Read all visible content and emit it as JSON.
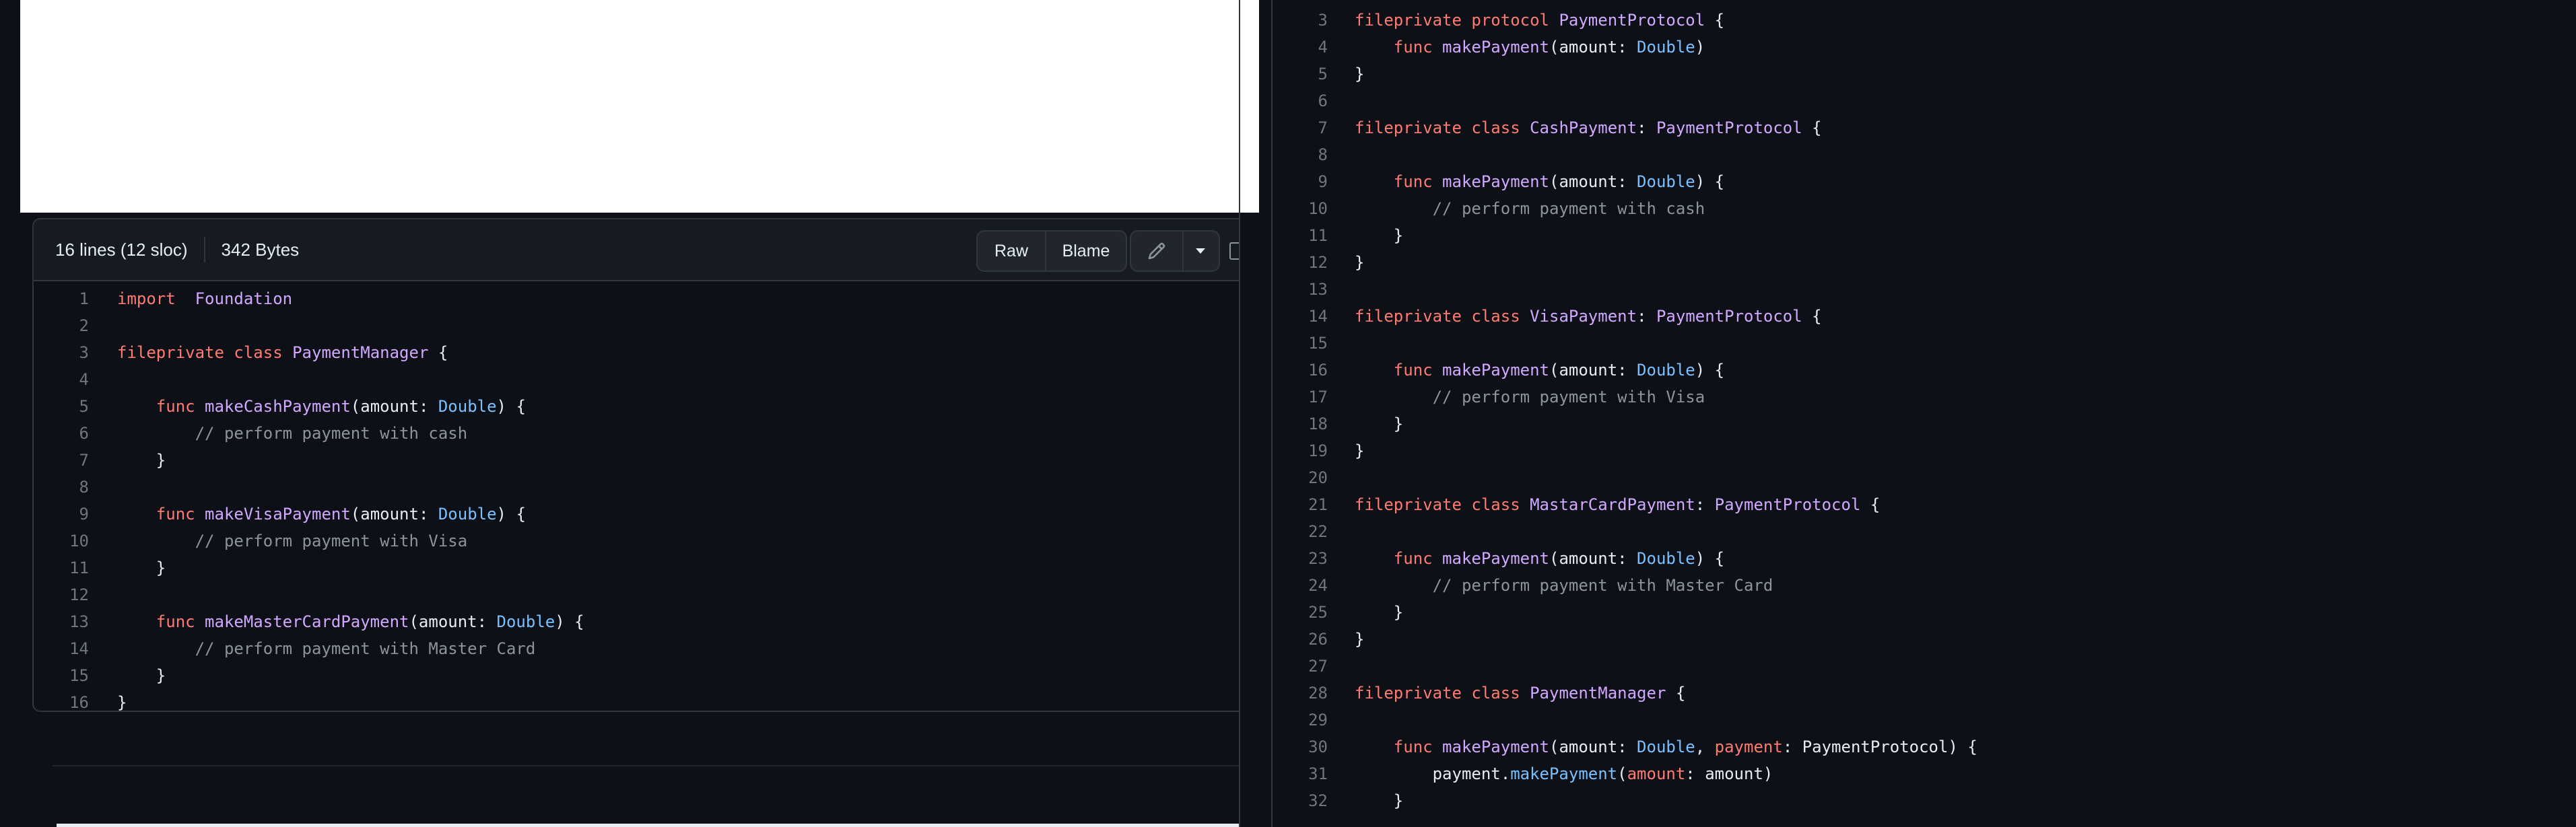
{
  "left_file": {
    "stats": {
      "lines": "16 lines (12 sloc)",
      "size": "342 Bytes"
    },
    "buttons": {
      "raw": "Raw",
      "blame": "Blame"
    },
    "icons": {
      "edit": "pencil-icon",
      "more": "caret-down-icon"
    },
    "lines": [
      {
        "n": "1",
        "t": [
          [
            "kw",
            "import"
          ],
          [
            "",
            "  "
          ],
          [
            "ty",
            "Foundation"
          ]
        ]
      },
      {
        "n": "2",
        "t": []
      },
      {
        "n": "3",
        "t": [
          [
            "kw",
            "fileprivate"
          ],
          [
            "",
            " "
          ],
          [
            "kw",
            "class"
          ],
          [
            "",
            " "
          ],
          [
            "ty",
            "PaymentManager"
          ],
          [
            "",
            " {"
          ]
        ]
      },
      {
        "n": "4",
        "t": []
      },
      {
        "n": "5",
        "t": [
          [
            "",
            "    "
          ],
          [
            "kw",
            "func"
          ],
          [
            "",
            " "
          ],
          [
            "ty",
            "makeCashPayment"
          ],
          [
            "",
            "(amount: "
          ],
          [
            "bu",
            "Double"
          ],
          [
            "",
            ") {"
          ]
        ]
      },
      {
        "n": "6",
        "t": [
          [
            "",
            "        "
          ],
          [
            "cm",
            "// perform payment with cash"
          ]
        ]
      },
      {
        "n": "7",
        "t": [
          [
            "",
            "    }"
          ]
        ]
      },
      {
        "n": "8",
        "t": []
      },
      {
        "n": "9",
        "t": [
          [
            "",
            "    "
          ],
          [
            "kw",
            "func"
          ],
          [
            "",
            " "
          ],
          [
            "ty",
            "makeVisaPayment"
          ],
          [
            "",
            "(amount: "
          ],
          [
            "bu",
            "Double"
          ],
          [
            "",
            ") {"
          ]
        ]
      },
      {
        "n": "10",
        "t": [
          [
            "",
            "        "
          ],
          [
            "cm",
            "// perform payment with Visa"
          ]
        ]
      },
      {
        "n": "11",
        "t": [
          [
            "",
            "    }"
          ]
        ]
      },
      {
        "n": "12",
        "t": []
      },
      {
        "n": "13",
        "t": [
          [
            "",
            "    "
          ],
          [
            "kw",
            "func"
          ],
          [
            "",
            " "
          ],
          [
            "ty",
            "makeMasterCardPayment"
          ],
          [
            "",
            "(amount: "
          ],
          [
            "bu",
            "Double"
          ],
          [
            "",
            ") {"
          ]
        ]
      },
      {
        "n": "14",
        "t": [
          [
            "",
            "        "
          ],
          [
            "cm",
            "// perform payment with Master Card"
          ]
        ]
      },
      {
        "n": "15",
        "t": [
          [
            "",
            "    }"
          ]
        ]
      },
      {
        "n": "16",
        "t": [
          [
            "",
            "}"
          ]
        ]
      }
    ]
  },
  "right_file": {
    "lines": [
      {
        "n": "3",
        "t": [
          [
            "kw",
            "fileprivate"
          ],
          [
            "",
            " "
          ],
          [
            "kw",
            "protocol"
          ],
          [
            "",
            " "
          ],
          [
            "ty",
            "PaymentProtocol"
          ],
          [
            "",
            " {"
          ]
        ]
      },
      {
        "n": "4",
        "t": [
          [
            "",
            "    "
          ],
          [
            "kw",
            "func"
          ],
          [
            "",
            " "
          ],
          [
            "ty",
            "makePayment"
          ],
          [
            "",
            "(amount: "
          ],
          [
            "bu",
            "Double"
          ],
          [
            "",
            ")"
          ]
        ]
      },
      {
        "n": "5",
        "t": [
          [
            "",
            "}"
          ]
        ]
      },
      {
        "n": "6",
        "t": []
      },
      {
        "n": "7",
        "t": [
          [
            "kw",
            "fileprivate"
          ],
          [
            "",
            " "
          ],
          [
            "kw",
            "class"
          ],
          [
            "",
            " "
          ],
          [
            "ty",
            "CashPayment"
          ],
          [
            "",
            ": "
          ],
          [
            "ty",
            "PaymentProtocol"
          ],
          [
            "",
            " {"
          ]
        ]
      },
      {
        "n": "8",
        "t": []
      },
      {
        "n": "9",
        "t": [
          [
            "",
            "    "
          ],
          [
            "kw",
            "func"
          ],
          [
            "",
            " "
          ],
          [
            "ty",
            "makePayment"
          ],
          [
            "",
            "(amount: "
          ],
          [
            "bu",
            "Double"
          ],
          [
            "",
            ") {"
          ]
        ]
      },
      {
        "n": "10",
        "t": [
          [
            "",
            "        "
          ],
          [
            "cm",
            "// perform payment with cash"
          ]
        ]
      },
      {
        "n": "11",
        "t": [
          [
            "",
            "    }"
          ]
        ]
      },
      {
        "n": "12",
        "t": [
          [
            "",
            "}"
          ]
        ]
      },
      {
        "n": "13",
        "t": []
      },
      {
        "n": "14",
        "t": [
          [
            "kw",
            "fileprivate"
          ],
          [
            "",
            " "
          ],
          [
            "kw",
            "class"
          ],
          [
            "",
            " "
          ],
          [
            "ty",
            "VisaPayment"
          ],
          [
            "",
            ": "
          ],
          [
            "ty",
            "PaymentProtocol"
          ],
          [
            "",
            " {"
          ]
        ]
      },
      {
        "n": "15",
        "t": []
      },
      {
        "n": "16",
        "t": [
          [
            "",
            "    "
          ],
          [
            "kw",
            "func"
          ],
          [
            "",
            " "
          ],
          [
            "ty",
            "makePayment"
          ],
          [
            "",
            "(amount: "
          ],
          [
            "bu",
            "Double"
          ],
          [
            "",
            ") {"
          ]
        ]
      },
      {
        "n": "17",
        "t": [
          [
            "",
            "        "
          ],
          [
            "cm",
            "// perform payment with Visa"
          ]
        ]
      },
      {
        "n": "18",
        "t": [
          [
            "",
            "    }"
          ]
        ]
      },
      {
        "n": "19",
        "t": [
          [
            "",
            "}"
          ]
        ]
      },
      {
        "n": "20",
        "t": []
      },
      {
        "n": "21",
        "t": [
          [
            "kw",
            "fileprivate"
          ],
          [
            "",
            " "
          ],
          [
            "kw",
            "class"
          ],
          [
            "",
            " "
          ],
          [
            "ty",
            "MastarCardPayment"
          ],
          [
            "",
            ": "
          ],
          [
            "ty",
            "PaymentProtocol"
          ],
          [
            "",
            " {"
          ]
        ]
      },
      {
        "n": "22",
        "t": []
      },
      {
        "n": "23",
        "t": [
          [
            "",
            "    "
          ],
          [
            "kw",
            "func"
          ],
          [
            "",
            " "
          ],
          [
            "ty",
            "makePayment"
          ],
          [
            "",
            "(amount: "
          ],
          [
            "bu",
            "Double"
          ],
          [
            "",
            ") {"
          ]
        ]
      },
      {
        "n": "24",
        "t": [
          [
            "",
            "        "
          ],
          [
            "cm",
            "// perform payment with Master Card"
          ]
        ]
      },
      {
        "n": "25",
        "t": [
          [
            "",
            "    }"
          ]
        ]
      },
      {
        "n": "26",
        "t": [
          [
            "",
            "}"
          ]
        ]
      },
      {
        "n": "27",
        "t": []
      },
      {
        "n": "28",
        "t": [
          [
            "kw",
            "fileprivate"
          ],
          [
            "",
            " "
          ],
          [
            "kw",
            "class"
          ],
          [
            "",
            " "
          ],
          [
            "ty",
            "PaymentManager"
          ],
          [
            "",
            " {"
          ]
        ]
      },
      {
        "n": "29",
        "t": []
      },
      {
        "n": "30",
        "t": [
          [
            "",
            "    "
          ],
          [
            "kw",
            "func"
          ],
          [
            "",
            " "
          ],
          [
            "ty",
            "makePayment"
          ],
          [
            "",
            "(amount: "
          ],
          [
            "bu",
            "Double"
          ],
          [
            "",
            ", "
          ],
          [
            "kw",
            "payment"
          ],
          [
            "",
            ": PaymentProtocol) {"
          ]
        ]
      },
      {
        "n": "31",
        "t": [
          [
            "",
            "        payment."
          ],
          [
            "bu",
            "makePayment"
          ],
          [
            "",
            "("
          ],
          [
            "kw",
            "amount"
          ],
          [
            "",
            ": amount)"
          ]
        ]
      },
      {
        "n": "32",
        "t": [
          [
            "",
            "    }"
          ]
        ]
      }
    ]
  },
  "colors": {
    "background": "#0d1117",
    "keyword": "#ff7b72",
    "type": "#d2a8ff",
    "builtin": "#79c0ff",
    "comment": "#8b949e",
    "text": "#e6edf3"
  }
}
